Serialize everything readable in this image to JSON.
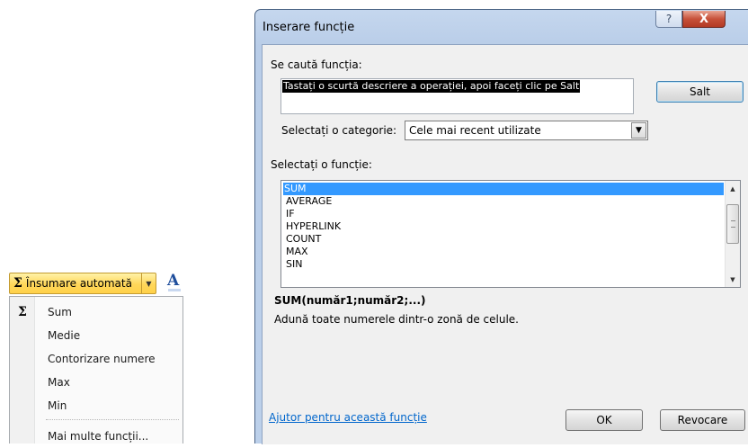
{
  "autosum": {
    "label": "Însumare automată",
    "sigma": "Σ",
    "font_icon_glyph": "A"
  },
  "menu": {
    "items": [
      {
        "icon": "Σ",
        "label": "Sum"
      },
      {
        "icon": "",
        "label": "Medie"
      },
      {
        "icon": "",
        "label": "Contorizare numere"
      },
      {
        "icon": "",
        "label": "Max"
      },
      {
        "icon": "",
        "label": "Min"
      },
      {
        "icon": "",
        "label": "Mai multe funcții..."
      }
    ]
  },
  "dialog": {
    "title": "Inserare funcție",
    "help_glyph": "?",
    "close_glyph": "X",
    "search": {
      "label": "Se caută funcția:",
      "value": "Tastați o scurtă descriere a operației, apoi faceți clic pe Salt",
      "go_label": "Salt"
    },
    "category": {
      "label": "Selectați o categorie:",
      "selected": "Cele mai recent utilizate"
    },
    "functions": {
      "label": "Selectați o funcție:",
      "items": [
        "SUM",
        "AVERAGE",
        "IF",
        "HYPERLINK",
        "COUNT",
        "MAX",
        "SIN"
      ],
      "selected": "SUM"
    },
    "syntax": "SUM(număr1;număr2;...)",
    "description": "Adună toate numerele dintr-o zonă de celule.",
    "help_link": "Ajutor pentru această funcție",
    "ok_label": "OK",
    "cancel_label": "Revocare"
  },
  "colors": {
    "selection": "#3399ff",
    "link": "#0066cc",
    "autosum_fill": "#ffd75a",
    "close_button": "#c7513a"
  }
}
